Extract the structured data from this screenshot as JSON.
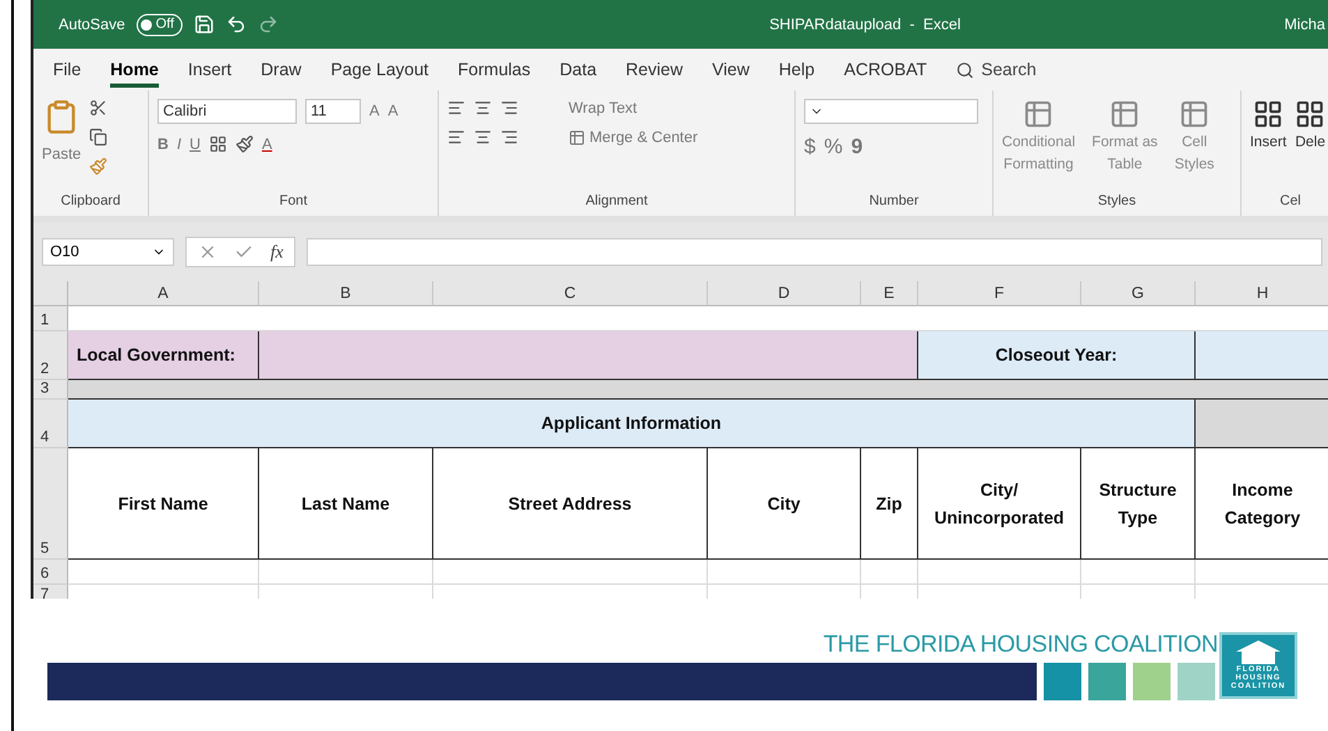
{
  "title_bar": {
    "autosave_label": "AutoSave",
    "autosave": {
      "on": false,
      "label": "Off"
    },
    "title": "SHIPARdataupload  -  Excel",
    "user": "Micha"
  },
  "menu_tabs": [
    {
      "label": "File",
      "selected": false
    },
    {
      "label": "Home",
      "selected": true
    },
    {
      "label": "Insert",
      "selected": false
    },
    {
      "label": "Draw",
      "selected": false
    },
    {
      "label": "Page Layout",
      "selected": false
    },
    {
      "label": "Formulas",
      "selected": false
    },
    {
      "label": "Data",
      "selected": false
    },
    {
      "label": "Review",
      "selected": false
    },
    {
      "label": "View",
      "selected": false
    },
    {
      "label": "Help",
      "selected": false
    },
    {
      "label": "ACROBAT",
      "selected": false
    }
  ],
  "search": {
    "placeholder": "Search"
  },
  "ribbon": [
    {
      "kind": "clipboard",
      "label": "Clipboard",
      "paste": "Paste"
    },
    {
      "kind": "font",
      "label": "Font",
      "font": "Calibri",
      "size": "11",
      "grow": "A",
      "shrink": "A",
      "bold": "B",
      "italic": "I",
      "underline": "U",
      "font_color": "A"
    },
    {
      "kind": "alignment",
      "label": "Alignment",
      "wrap": "Wrap Text",
      "merge": "Merge & Center"
    },
    {
      "kind": "number",
      "label": "Number",
      "currency": "$",
      "percent": "%",
      "comma": "9"
    },
    {
      "kind": "styles",
      "label": "Styles",
      "buttons": [
        {
          "top": "Conditional",
          "bottom": "Formatting"
        },
        {
          "top": "Format as",
          "bottom": "Table"
        },
        {
          "top": "Cell",
          "bottom": "Styles"
        }
      ]
    },
    {
      "kind": "cells",
      "label": "Cel",
      "buttons": [
        "Insert",
        "Dele"
      ]
    }
  ],
  "formula_bar": {
    "name_box": "O10",
    "fx": "fx"
  },
  "columns": [
    "A",
    "B",
    "C",
    "D",
    "E",
    "F",
    "G",
    "H"
  ],
  "rows": [
    {
      "number": "1",
      "cells": [
        {
          "kind": "blank"
        }
      ]
    },
    {
      "number": "2",
      "cells": [
        {
          "kind": "pink-label",
          "text": "Local Government:"
        },
        {
          "kind": "pink-entry"
        },
        {
          "kind": "blue-label",
          "text": "Closeout Year:"
        },
        {
          "kind": "blue-entry"
        }
      ]
    },
    {
      "number": "3",
      "cells": [
        {
          "kind": "grey-fill"
        }
      ]
    },
    {
      "number": "4",
      "cells": [
        {
          "kind": "section-heading",
          "text": "Applicant Information"
        },
        {
          "kind": "grey-fill"
        }
      ]
    },
    {
      "number": "5",
      "cells": [
        {
          "kind": "column-heading",
          "text": "First Name"
        },
        {
          "kind": "column-heading",
          "text": "Last Name"
        },
        {
          "kind": "column-heading",
          "text": "Street Address"
        },
        {
          "kind": "column-heading",
          "text": "City"
        },
        {
          "kind": "column-heading",
          "text": "Zip"
        },
        {
          "kind": "column-heading",
          "text": "City/ Unincorporated"
        },
        {
          "kind": "column-heading",
          "text": "Structure Type"
        },
        {
          "kind": "column-heading",
          "text": "Income Category"
        }
      ]
    },
    {
      "number": "6",
      "cells": [
        {
          "kind": "blank"
        },
        {
          "kind": "blank"
        },
        {
          "kind": "blank"
        },
        {
          "kind": "blank"
        },
        {
          "kind": "blank"
        },
        {
          "kind": "blank"
        },
        {
          "kind": "blank"
        },
        {
          "kind": "blank"
        }
      ]
    },
    {
      "number": "7",
      "cells": [
        {
          "kind": "blank"
        },
        {
          "kind": "blank"
        },
        {
          "kind": "blank"
        },
        {
          "kind": "blank"
        },
        {
          "kind": "blank"
        },
        {
          "kind": "blank"
        },
        {
          "kind": "blank"
        },
        {
          "kind": "blank"
        }
      ]
    }
  ],
  "footer": {
    "tagline": "THE FLORIDA HOUSING COALITION",
    "badge_lines": [
      "FLORIDA",
      "HOUSING",
      "COALITION"
    ]
  }
}
